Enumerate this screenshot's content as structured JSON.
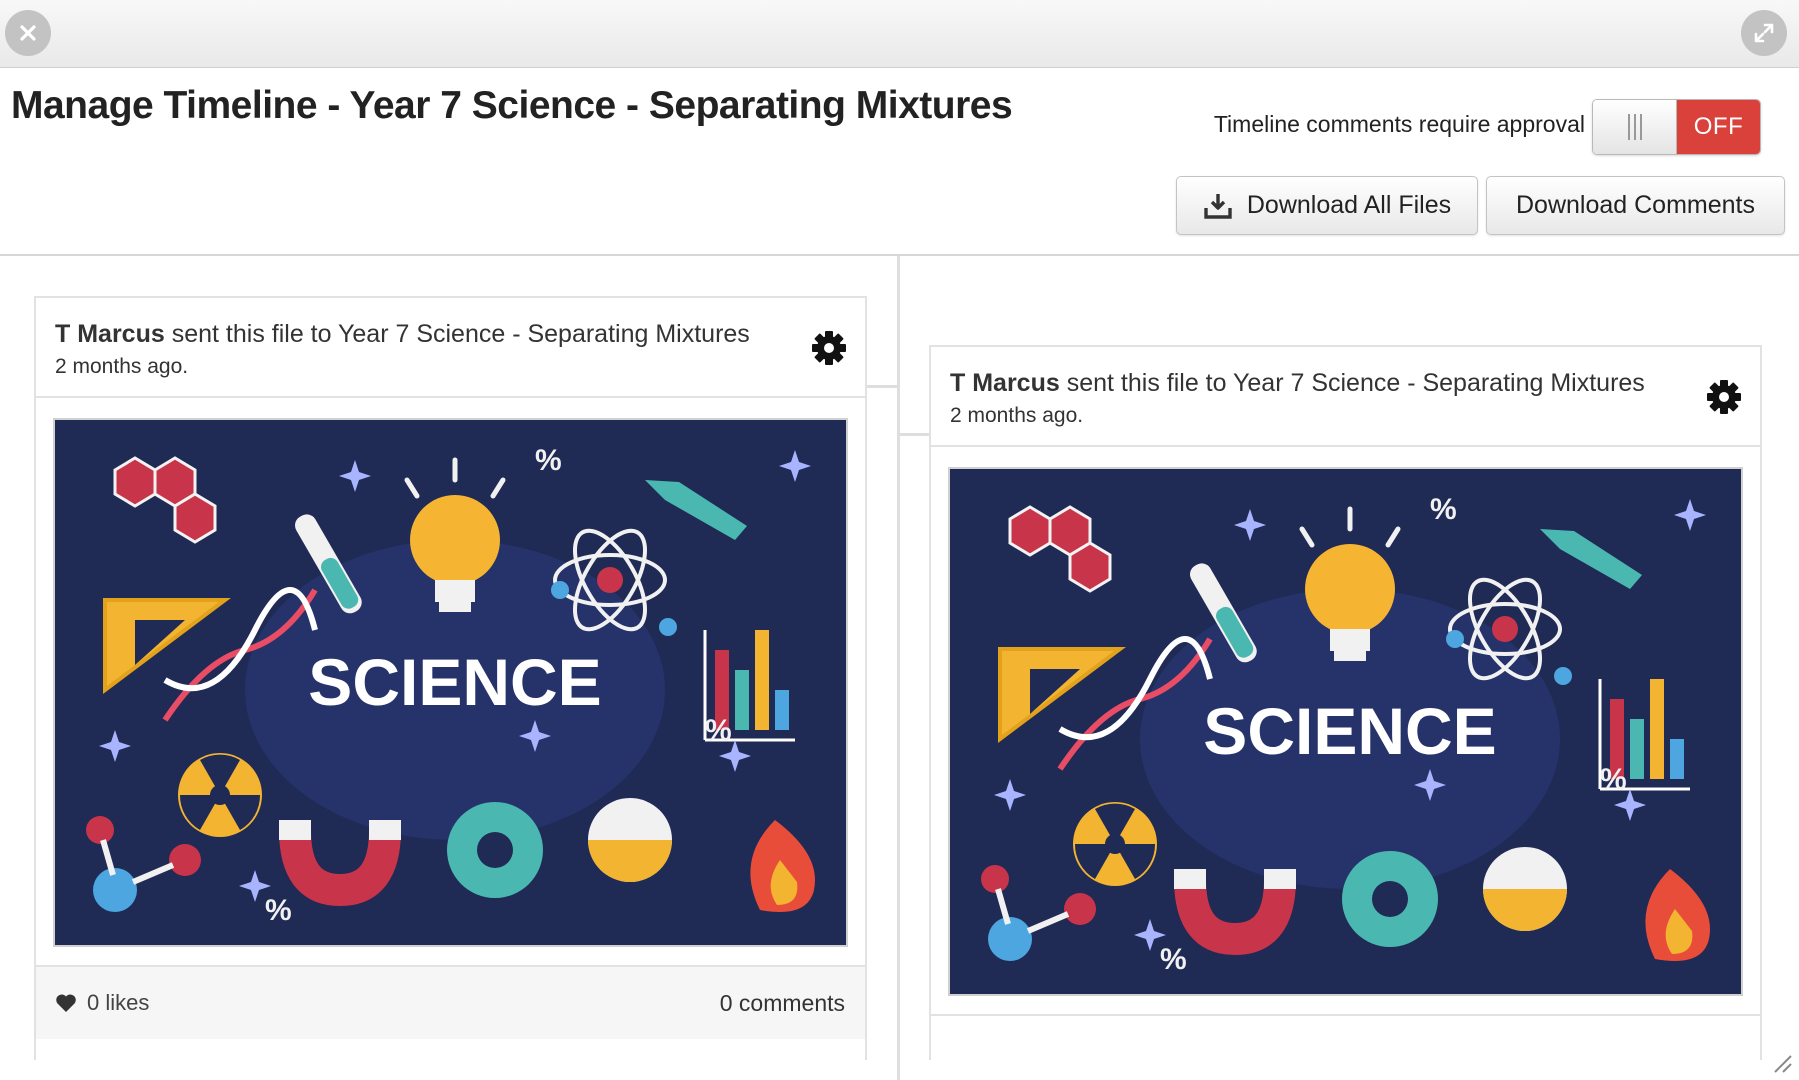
{
  "window": {
    "close_icon": "close-icon",
    "expand_icon": "expand-icon"
  },
  "header": {
    "title": "Manage Timeline - Year 7 Science - Separating Mixtures",
    "approval_label": "Timeline comments require approval",
    "toggle_state": "OFF",
    "download_files_label": "Download All Files",
    "download_comments_label": "Download Comments"
  },
  "colors": {
    "toggle_off": "#d9413a",
    "image_background": "#1f2a55"
  },
  "posts": [
    {
      "author": "T Marcus",
      "action": " sent this file to Year 7 Science - Separating Mixtures",
      "time": "2 months ago.",
      "image_text": "SCIENCE",
      "likes": "0 likes",
      "comments": "0 comments"
    },
    {
      "author": "T Marcus",
      "action": " sent this file to Year 7 Science - Separating Mixtures",
      "time": "2 months ago.",
      "image_text": "SCIENCE"
    }
  ]
}
